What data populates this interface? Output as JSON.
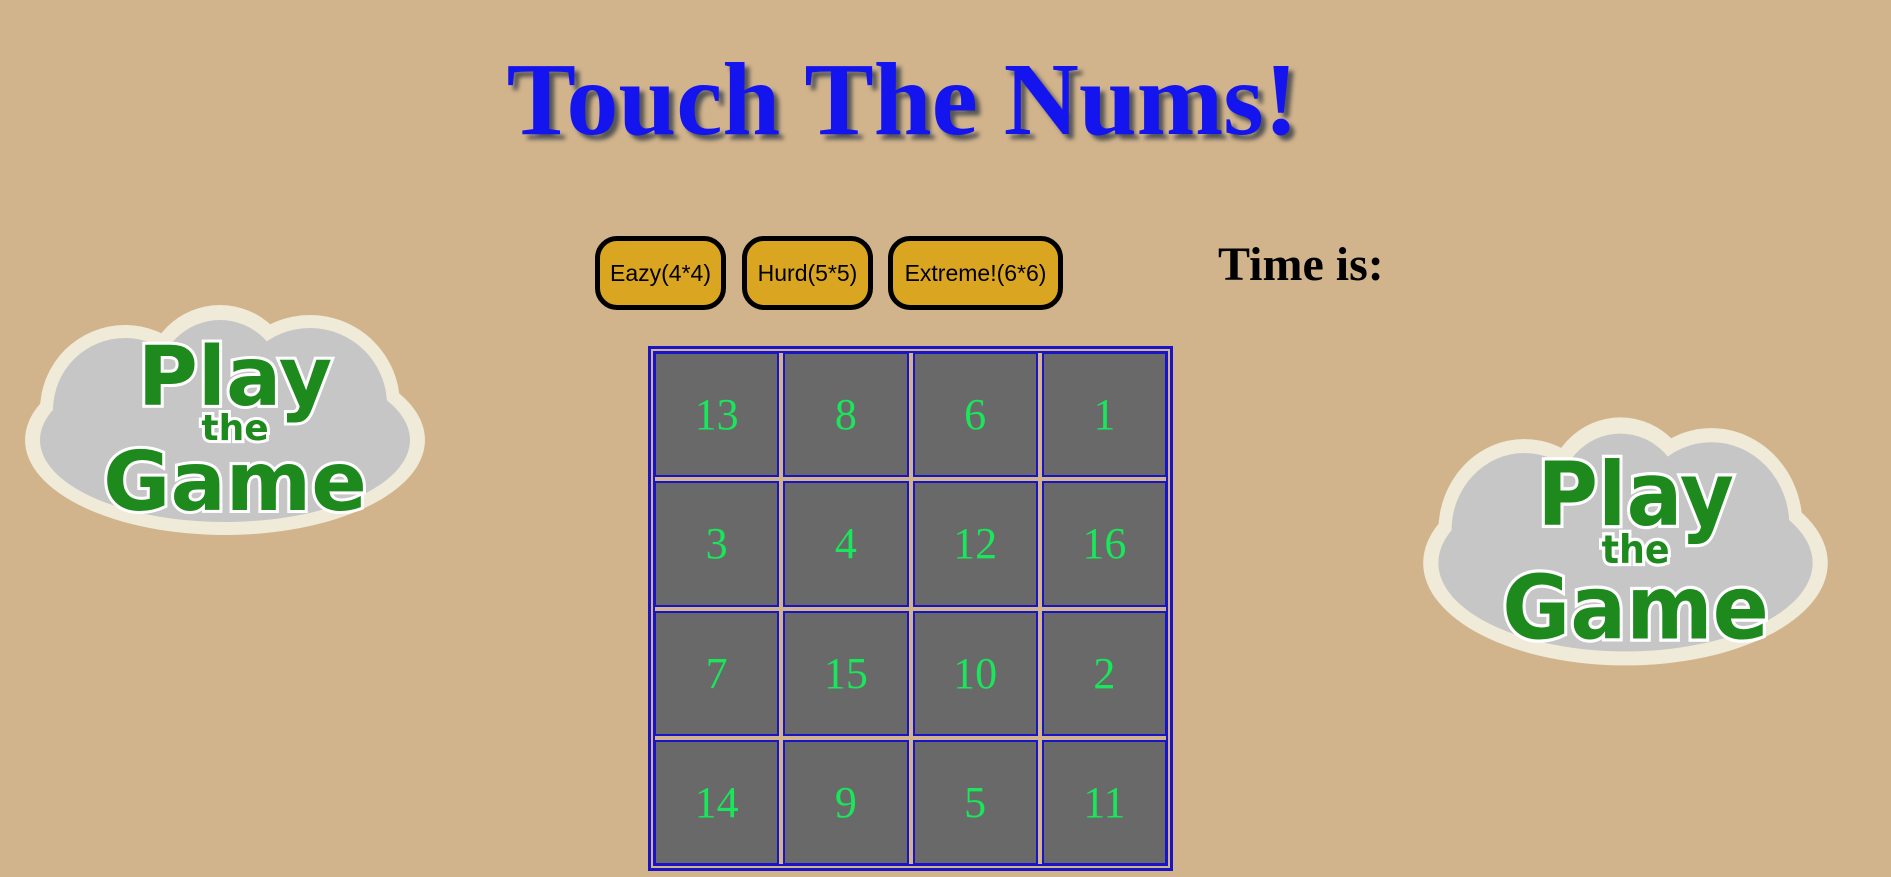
{
  "title": "Touch The Nums!",
  "difficulty_buttons": {
    "easy": "Eazy(4*4)",
    "hard": "Hurd(5*5)",
    "extreme": "Extreme!(6*6)"
  },
  "timer_label": "Time is:",
  "board": {
    "size": "4*4",
    "cells": [
      "13",
      "8",
      "6",
      "1",
      "3",
      "4",
      "12",
      "16",
      "7",
      "15",
      "10",
      "2",
      "14",
      "9",
      "5",
      "11"
    ]
  },
  "logo": {
    "line1": "Play",
    "line2": "the",
    "line3": "Game"
  },
  "colors": {
    "background": "#d2b48c",
    "title": "#1414ee",
    "button": "#daa520",
    "cell": "#696969",
    "cell_text": "#19e65a",
    "board_border": "#1a14c8"
  }
}
